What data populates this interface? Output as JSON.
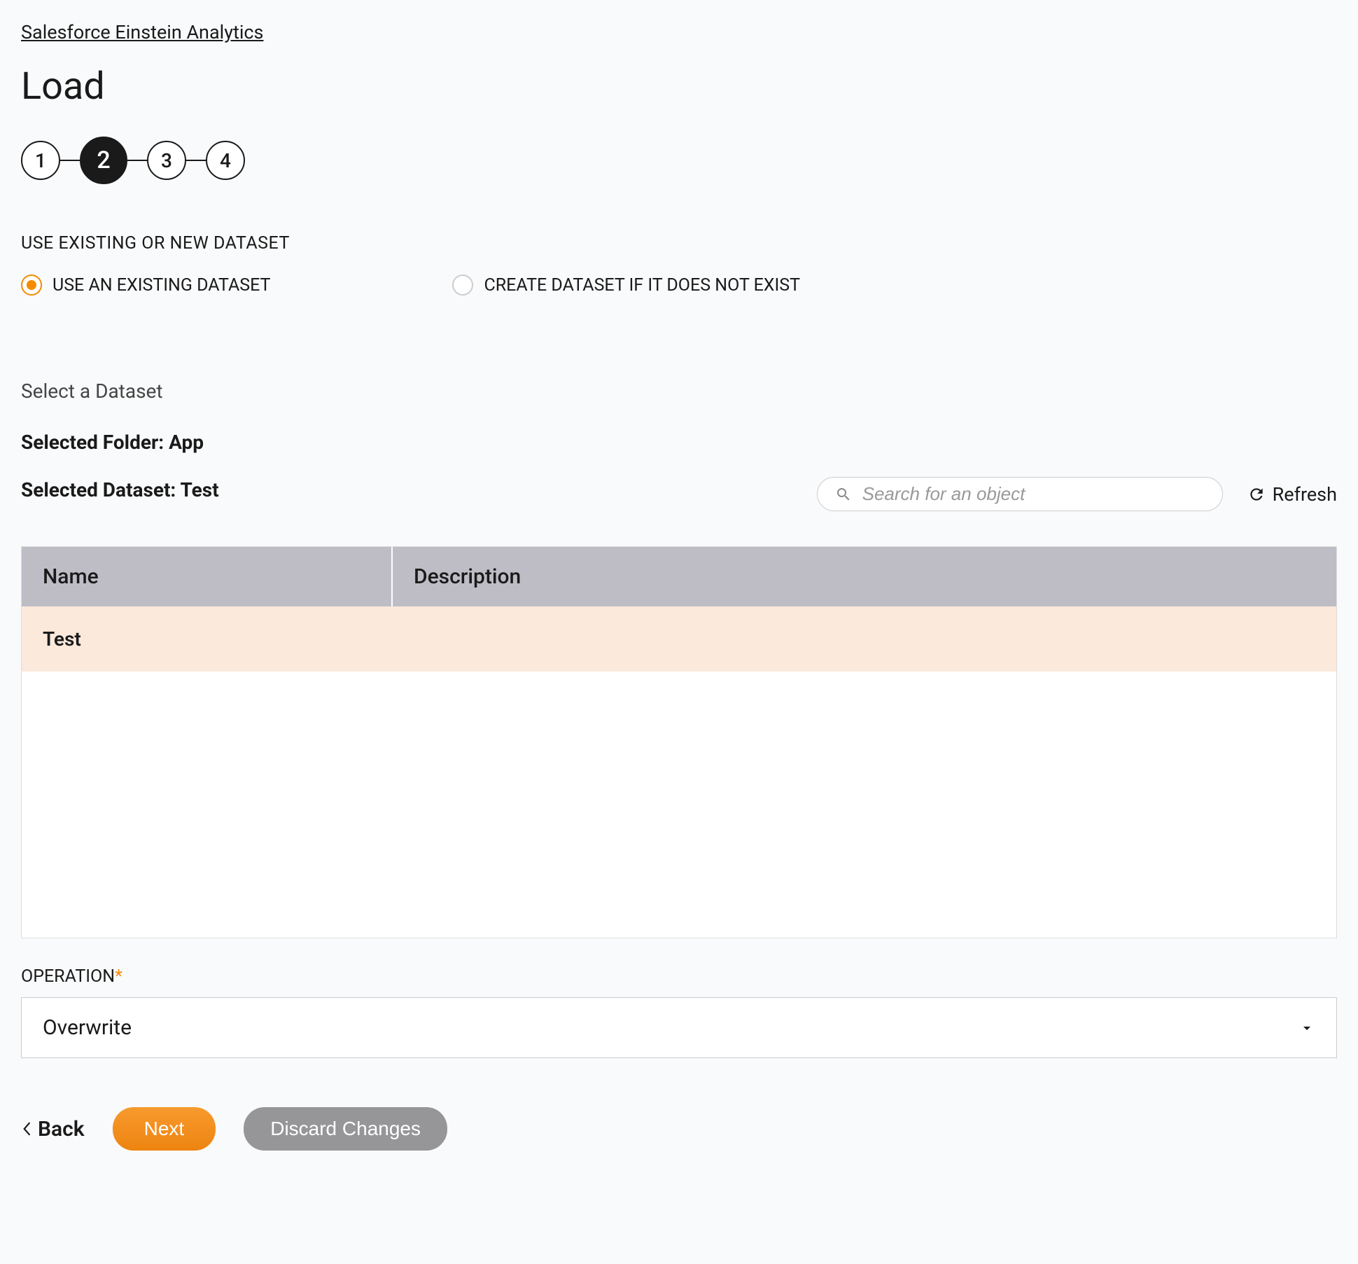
{
  "breadcrumb": "Salesforce Einstein Analytics",
  "page_title": "Load",
  "stepper": {
    "steps": [
      "1",
      "2",
      "3",
      "4"
    ],
    "active_index": 1
  },
  "dataset_section": {
    "label": "USE EXISTING OR NEW DATASET",
    "options": [
      {
        "label": "USE AN EXISTING DATASET",
        "selected": true
      },
      {
        "label": "CREATE DATASET IF IT DOES NOT EXIST",
        "selected": false
      }
    ]
  },
  "select_dataset": {
    "label": "Select a Dataset",
    "selected_folder_label": "Selected Folder: App",
    "selected_dataset_label": "Selected Dataset: Test"
  },
  "search": {
    "placeholder": "Search for an object",
    "value": ""
  },
  "refresh_label": "Refresh",
  "table": {
    "headers": {
      "name": "Name",
      "description": "Description"
    },
    "rows": [
      {
        "name": "Test",
        "description": ""
      }
    ]
  },
  "operation": {
    "label": "OPERATION",
    "required": "*",
    "value": "Overwrite"
  },
  "buttons": {
    "back": "Back",
    "next": "Next",
    "discard": "Discard Changes"
  }
}
